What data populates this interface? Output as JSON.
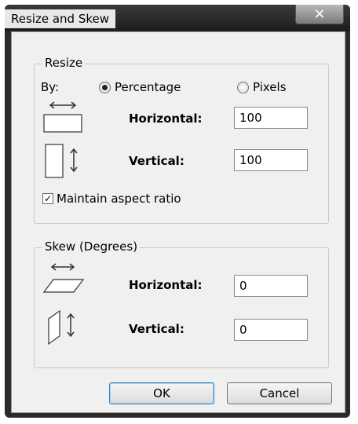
{
  "window": {
    "title": "Resize and Skew",
    "close_label": "✕"
  },
  "resize": {
    "group_label": "Resize",
    "by_label": "By:",
    "percentage_label": "Percentage",
    "pixels_label": "Pixels",
    "selected_mode": "Percentage",
    "horizontal_label": "Horizontal:",
    "horizontal_value": "100",
    "vertical_label": "Vertical:",
    "vertical_value": "100",
    "maintain_label": "Maintain aspect ratio",
    "maintain_checked": true,
    "check_mark": "✓"
  },
  "skew": {
    "group_label": "Skew (Degrees)",
    "horizontal_label": "Horizontal:",
    "horizontal_value": "0",
    "vertical_label": "Vertical:",
    "vertical_value": "0"
  },
  "buttons": {
    "ok_label": "OK",
    "cancel_label": "Cancel"
  }
}
